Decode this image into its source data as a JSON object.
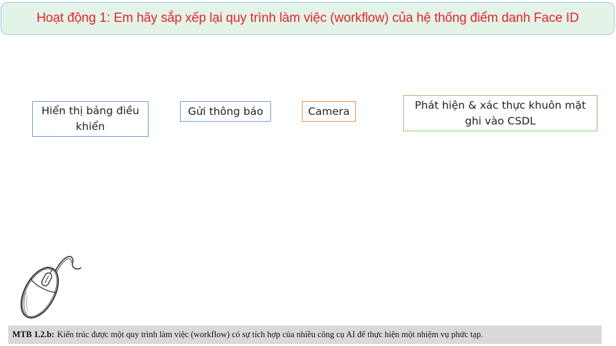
{
  "header": {
    "title": "Hoạt động 1: Em hãy sắp xếp lại quy trình làm việc (workflow) của hệ thống điểm danh Face ID"
  },
  "steps": [
    {
      "id": "dashboard",
      "label": "Hiển thị bảng điều khiển",
      "border_color": "#6f9fd8"
    },
    {
      "id": "notify",
      "label": "Gửi thông báo",
      "border_color": "#6f9fd8"
    },
    {
      "id": "camera",
      "label": "Camera",
      "border_color": "#f08a5b"
    },
    {
      "id": "detect",
      "label": "Phát hiện & xác thực khuôn mặt ghi vào CSDL",
      "border_color": "#93c47d"
    }
  ],
  "decoration": {
    "icon": "computer-mouse-icon"
  },
  "footer": {
    "code": "MTB 1.2.b:",
    "text": "Kiến trúc được một quy trình làm việc (workflow) có sự tích hợp của nhiều công cụ AI để thực hiện một nhiệm vụ phức tạp."
  },
  "colors": {
    "title_text": "#e3262b",
    "title_background": "#e3f3e7",
    "title_border": "#9fc7e0",
    "footer_background": "#d9d9d9"
  }
}
